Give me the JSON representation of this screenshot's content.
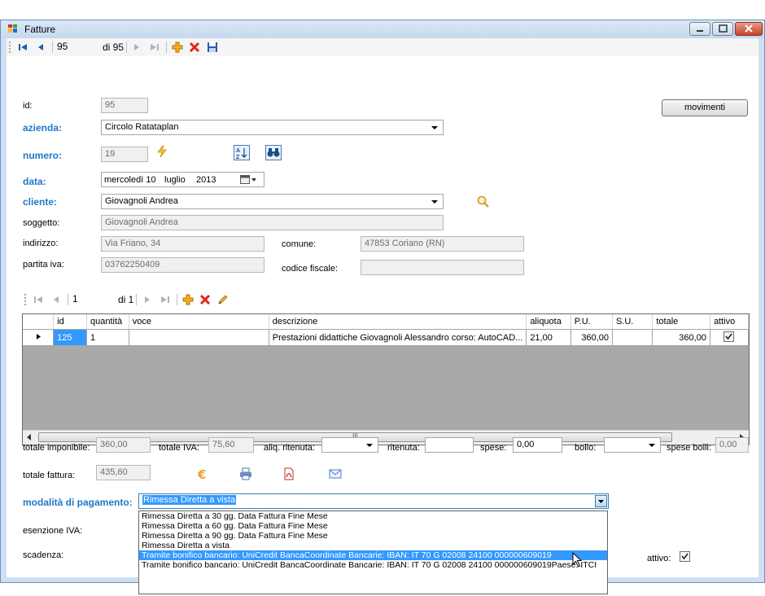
{
  "window": {
    "title": "Fatture"
  },
  "nav": {
    "position": "95",
    "of_total": "di 95"
  },
  "header_button": "movimenti",
  "form": {
    "id_label": "id:",
    "id_value": "95",
    "azienda_label": "azienda:",
    "azienda_value": "Circolo Ratataplan",
    "numero_label": "numero:",
    "numero_value": "19",
    "data_label": "data:",
    "data_day": "mercoledì 10",
    "data_month": "luglio",
    "data_year": "2013",
    "cliente_label": "cliente:",
    "cliente_value": "Giovagnoli Andrea",
    "soggetto_label": "soggetto:",
    "soggetto_value": "Giovagnoli Andrea",
    "indirizzo_label": "indirizzo:",
    "indirizzo_value": "Via Friano, 34",
    "comune_label": "comune:",
    "comune_value": "47853 Coriano (RN)",
    "piva_label": "partita iva:",
    "piva_value": "03762250409",
    "cf_label": "codice fiscale:",
    "cf_value": ""
  },
  "subnav": {
    "position": "1",
    "of_total": "di 1"
  },
  "grid": {
    "columns": [
      "id",
      "quantità",
      "voce",
      "descrizione",
      "aliquota",
      "P.U.",
      "S.U.",
      "totale",
      "attivo"
    ],
    "rows": [
      {
        "id": "125",
        "quantita": "1",
        "voce": "",
        "descrizione": "Prestazioni didattiche Giovagnoli Alessandro corso: AutoCAD...",
        "aliquota": "21,00",
        "pu": "360,00",
        "su": "",
        "totale": "360,00",
        "attivo": true
      }
    ],
    "scroll_grip": "III"
  },
  "totals": {
    "imponibile_label": "totale imponibile:",
    "imponibile_value": "360,00",
    "iva_label": "totale IVA:",
    "iva_value": "75,60",
    "aliq_rit_label": "aliq. ritenuta:",
    "aliq_rit_value": "",
    "ritenuta_label": "ritenuta:",
    "ritenuta_value": "",
    "spese_label": "spese:",
    "spese_value": "0,00",
    "bollo_label": "bollo:",
    "bollo_value": "",
    "spese_bolli_label": "spese bolli:",
    "spese_bolli_value": "0,00",
    "fattura_label": "totale fattura:",
    "fattura_value": "435,60"
  },
  "pagamento": {
    "label": "modalità di pagamento:",
    "value": "Rimessa Diretta a vista",
    "options": [
      "Rimessa Diretta a 30 gg. Data Fattura Fine Mese",
      "Rimessa Diretta a 60 gg. Data Fattura Fine Mese",
      "Rimessa Diretta a 90 gg. Data Fattura Fine Mese",
      "Rimessa Diretta a vista",
      "Tramite bonifico bancario: UniCredit BancaCoordinate Bancarie: IBAN: IT 70 G 02008 24100 000000609019",
      "Tramite bonifico bancario: UniCredit BancaCoordinate Bancarie: IBAN: IT 70 G 02008 24100 000000609019Paese: ITCI"
    ],
    "highlighted_index": 4
  },
  "esenzione_label": "esenzione IVA:",
  "scadenza_label": "scadenza:",
  "attivo_label": "attivo:",
  "colors": {
    "accent_label": "#1e78c8",
    "selection": "#3399ff"
  }
}
